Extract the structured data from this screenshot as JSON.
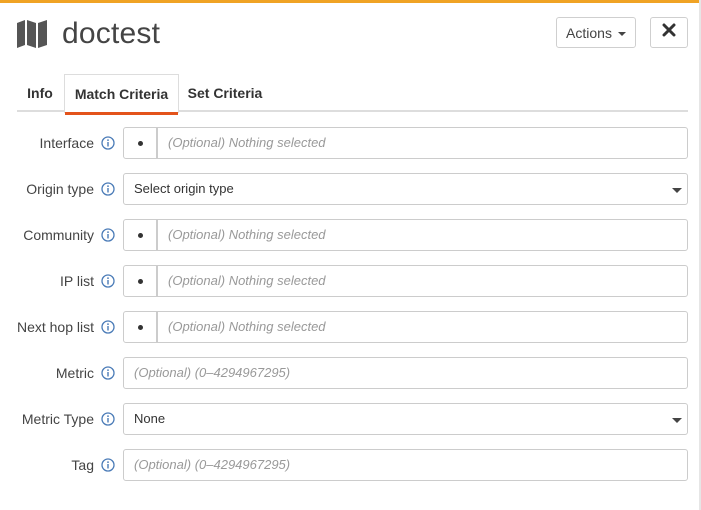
{
  "header": {
    "title": "doctest",
    "actions_label": "Actions",
    "close_label": "close"
  },
  "tabs": [
    {
      "label": "Info"
    },
    {
      "label": "Match Criteria",
      "active": true
    },
    {
      "label": "Set Criteria"
    }
  ],
  "form": {
    "interface": {
      "label": "Interface",
      "placeholder": "(Optional) Nothing selected"
    },
    "origin_type": {
      "label": "Origin type",
      "value": "Select origin type"
    },
    "community": {
      "label": "Community",
      "placeholder": "(Optional) Nothing selected"
    },
    "ip_list": {
      "label": "IP list",
      "placeholder": "(Optional) Nothing selected"
    },
    "next_hop_list": {
      "label": "Next hop list",
      "placeholder": "(Optional) Nothing selected"
    },
    "metric": {
      "label": "Metric",
      "placeholder": "(Optional) (0–4294967295)"
    },
    "metric_type": {
      "label": "Metric Type",
      "value": "None"
    },
    "tag": {
      "label": "Tag",
      "placeholder": "(Optional) (0–4294967295)"
    }
  },
  "colors": {
    "accent_bar": "#f0a324",
    "active_tab_underline": "#e3531b",
    "info_icon": "#4a7bb7"
  },
  "icons": {
    "title": "map-icon",
    "close": "close-icon",
    "info": "info-icon",
    "dropdown": "chevron-down-icon"
  }
}
